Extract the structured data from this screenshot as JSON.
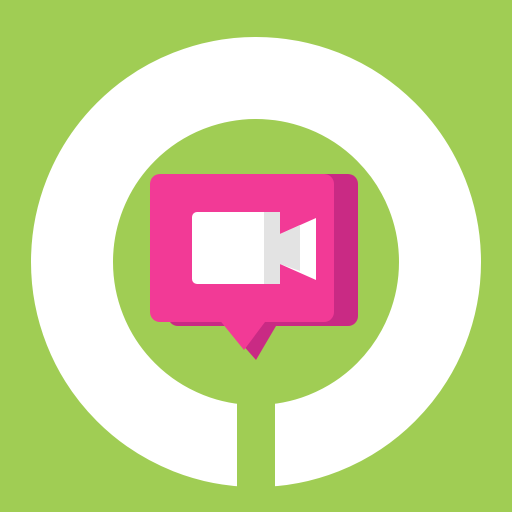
{
  "icon": {
    "name": "video-chat-app-icon",
    "glyph": "video-camera-icon",
    "container": "speech-bubble-icon"
  },
  "colors": {
    "background": "#a0cd54",
    "ring": "#ffffff",
    "bubble_front": "#f23a96",
    "bubble_shadow": "#c92a84",
    "camera": "#ffffff",
    "camera_shade": "#e3e3e3"
  }
}
